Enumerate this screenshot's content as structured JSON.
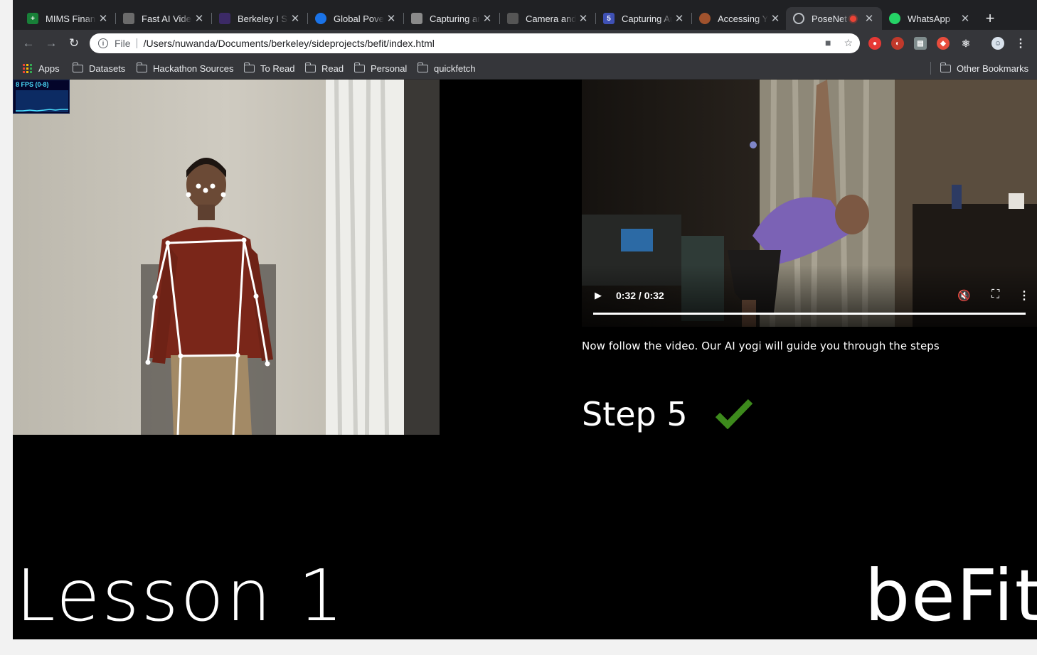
{
  "browser": {
    "tabs": [
      {
        "title": "MIMS Financ",
        "icon": "sheets-icon",
        "color": "#188038",
        "glyph": "+"
      },
      {
        "title": "Fast AI Video",
        "icon": "page-icon",
        "color": "#6b6b6b",
        "glyph": ""
      },
      {
        "title": "Berkeley I Sc",
        "icon": "berkeley-icon",
        "color": "#3c2a66",
        "glyph": ""
      },
      {
        "title": "Global Pover",
        "icon": "globe-icon",
        "color": "#1a73e8",
        "glyph": ""
      },
      {
        "title": "Capturing ar",
        "icon": "capture-icon",
        "color": "#8a8a8a",
        "glyph": ""
      },
      {
        "title": "Camera and",
        "icon": "camera-icon",
        "color": "#555555",
        "glyph": ""
      },
      {
        "title": "Capturing Au",
        "icon": "html5-icon",
        "color": "#3f51b5",
        "glyph": "5"
      },
      {
        "title": "Accessing Y",
        "icon": "owl-icon",
        "color": "#a0522d",
        "glyph": ""
      },
      {
        "title": "PoseNet",
        "icon": "globe-icon",
        "color": "#bdc1c6",
        "glyph": "",
        "active": true,
        "recording": true
      },
      {
        "title": "WhatsApp",
        "icon": "whatsapp-icon",
        "color": "#25d366",
        "glyph": ""
      }
    ],
    "address": {
      "scheme": "File",
      "url": "/Users/nuwanda/Documents/berkeley/sideprojects/befit/index.html"
    },
    "bookmarks": [
      {
        "label": "Apps",
        "icon": "apps-grid-icon"
      },
      {
        "label": "Datasets",
        "icon": "folder-icon"
      },
      {
        "label": "Hackathon Sources",
        "icon": "folder-icon"
      },
      {
        "label": "To Read",
        "icon": "folder-icon"
      },
      {
        "label": "Read",
        "icon": "folder-icon"
      },
      {
        "label": "Personal",
        "icon": "folder-icon"
      },
      {
        "label": "quickfetch",
        "icon": "folder-icon"
      }
    ],
    "other_bookmarks": "Other Bookmarks"
  },
  "page": {
    "fps_label": "8 FPS (0-8)",
    "video": {
      "time": "0:32 / 0:32",
      "progress": 1.0
    },
    "instruction": "Now follow the video. Our AI yogi will guide you through the steps",
    "step_label": "Step 5",
    "check_color": "#3d8a1c",
    "lesson_label": "Lesson 1",
    "brand": "beFit"
  }
}
